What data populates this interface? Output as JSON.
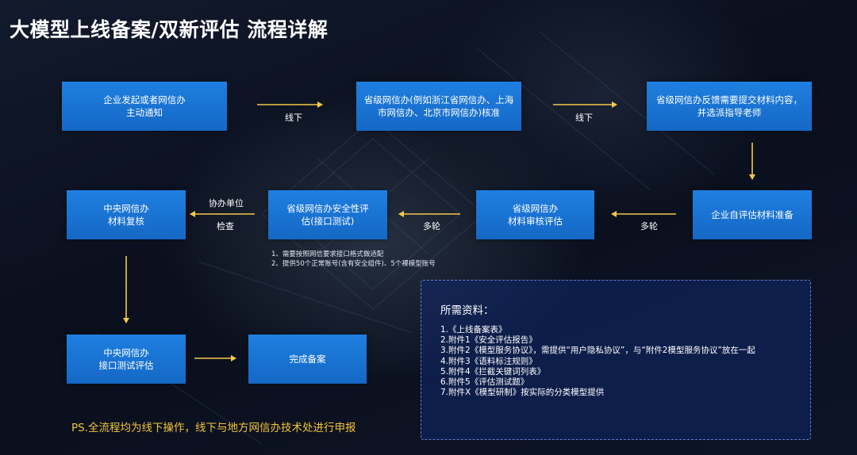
{
  "title": "大模型上线备案/双新评估  流程详解",
  "colors": {
    "box": "#1a73d9",
    "arrow": "#f4c84a",
    "ps_text": "#f2c438",
    "panel_border": "#5f7fc8"
  },
  "boxes": {
    "b1": "企业发起或者网信办\n主动通知",
    "b2": "省级网信办(例如浙江省网信办、上海\n市网信办、北京市网信办)核准",
    "b3": "省级网信办反馈需要提交材料内容，\n并选派指导老师",
    "b4": "企业自评估材料准备",
    "b5": "省级网信办\n材料审核评估",
    "b6": "省级网信办安全性评\n估(接口测试)",
    "b7": "中央网信办\n材料复核",
    "b8": "中央网信办\n接口测试评估",
    "b9": "完成备案"
  },
  "edge_labels": {
    "b1_b2": "线下",
    "b2_b3": "线下",
    "b4_b5": "多轮",
    "b5_b6": "多轮",
    "b6_b7_top": "协办单位",
    "b6_b7_bottom": "检查"
  },
  "notes": [
    "1、需要按照网信要求接口格式做适配",
    "2、提供50个正常账号(含有安全组件)、5个裸模型账号"
  ],
  "panel": {
    "title": "所需资料：",
    "items": [
      "1.《上线备案表》",
      "2.附件1《安全评估报告》",
      "3.附件2《模型服务协议》，需提供“用户隐私协议”，与“附件2模型服务协议”放在一起",
      "4.附件3《语料标注规则》",
      "5.附件4《拦截关键词列表》",
      "6.附件5《评估测试题》",
      "7.附件X《模型研制》按实际的分类模型提供"
    ]
  },
  "ps": "PS.全流程均为线下操作，线下与地方网信办技术处进行申报"
}
